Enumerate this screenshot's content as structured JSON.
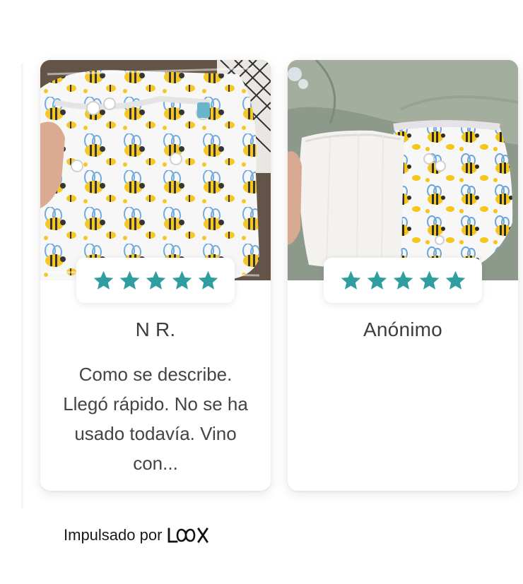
{
  "reviews": [
    {
      "name": "N R.",
      "rating": 5,
      "text": "Como se describe. Llegó rápido. No se ha usado todavía. Vino con..."
    },
    {
      "name": "Anónimo",
      "rating": 5,
      "text": ""
    }
  ],
  "footer": {
    "powered_by": "Impulsado por",
    "brand": "LOOX"
  },
  "colors": {
    "star": "#2f9ea0",
    "bee_yellow": "#f5c518",
    "wing_blue": "#6aa6dc"
  }
}
